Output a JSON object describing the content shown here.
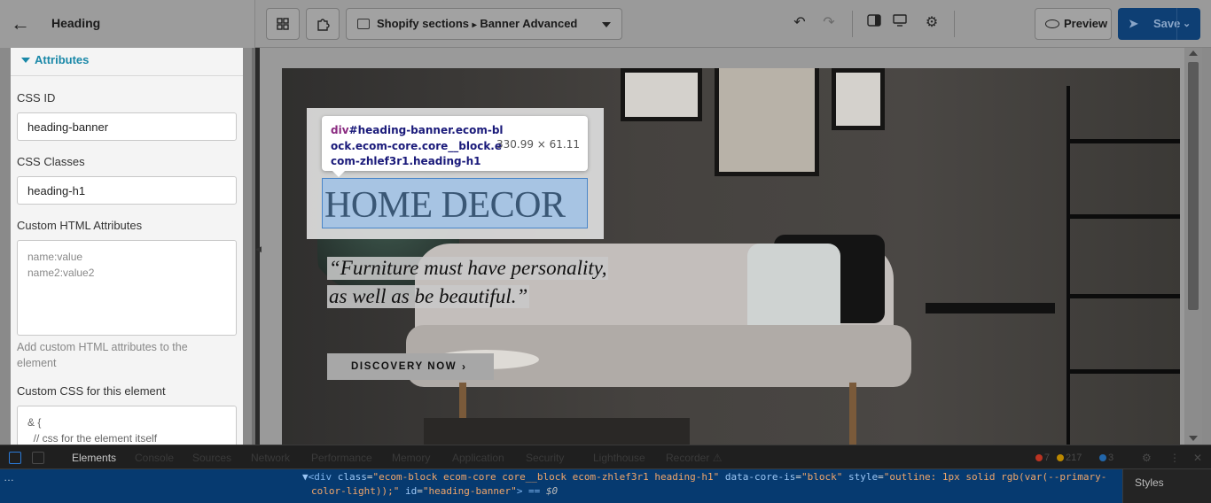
{
  "header": {
    "back_label": "←",
    "title": "Heading",
    "section_selector": {
      "source": "Shopify sections",
      "separator": "▸",
      "current": "Banner Advanced"
    },
    "preview_label": "Preview",
    "save_label": "Save"
  },
  "left_panel": {
    "section_title": "Attributes",
    "css_id_label": "CSS ID",
    "css_id_value": "heading-banner",
    "css_classes_label": "CSS Classes",
    "css_classes_value": "heading-h1",
    "custom_attrs_label": "Custom HTML Attributes",
    "custom_attrs_placeholder": "name:value\nname2:value2",
    "custom_attrs_help": "Add custom HTML attributes to the element",
    "custom_css_label": "Custom CSS for this element",
    "custom_css_value": "& {\n  // css for the element itself"
  },
  "canvas": {
    "inspector_tag": "div",
    "inspector_selector": "#heading-banner.ecom-block.ecom-core.core__block.ecom-zhlef3r1.heading-h1",
    "inspector_dims": "330.99 × 61.11",
    "heading": "HOME DECOR",
    "quote_line1": "“Furniture must have personality,",
    "quote_line2": "as well as be beautiful.”",
    "cta_label": "DISCOVERY NOW",
    "cta_arrow": "›"
  },
  "devtools": {
    "tabs": [
      "Elements",
      "Console",
      "Sources",
      "Network",
      "Performance",
      "Memory",
      "Application",
      "Security",
      "Lighthouse",
      "Recorder ⚠"
    ],
    "active_tab": "Elements",
    "errors": "7",
    "warnings": "217",
    "messages": "3",
    "gutter": "…",
    "code_line1_prefix": "▼",
    "code_tag_open": "<div",
    "code_attr_class": "class",
    "code_val_class": "\"ecom-block ecom-core core__block ecom-zhlef3r1 heading-h1\"",
    "code_attr_datacore": "data-core-is",
    "code_val_datacore": "\"block\"",
    "code_attr_style": "style",
    "code_val_style_1": "\"outline: 1px solid rgb(var(--primary-",
    "code_val_style_2": "color-light));\"",
    "code_attr_id": "id",
    "code_val_id": "\"heading-banner\"",
    "code_tail": "> == ",
    "code_dollar": "$0",
    "styles_label": "Styles"
  },
  "colors": {
    "accent": "#1a88a8",
    "save_bg": "#0e3f74",
    "selection_highlight": "#a7c4e3",
    "devtools_selected_row": "#063a70"
  }
}
